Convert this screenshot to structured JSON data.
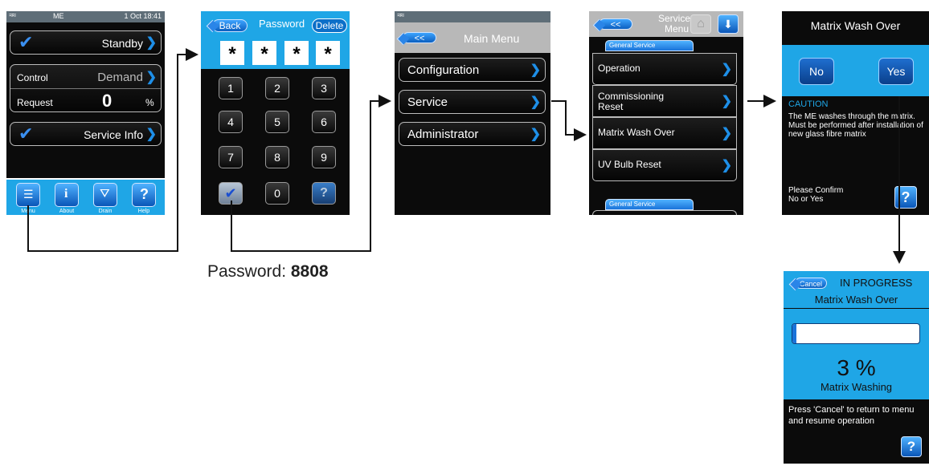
{
  "screen1": {
    "app_title": "ME",
    "datetime": "1 Oct 18:41",
    "standby_label": "Standby",
    "control_label": "Control",
    "control_value": "Demand",
    "request_label": "Request",
    "request_value": "0",
    "request_unit": "%",
    "service_info_label": "Service Info",
    "footer_icons": [
      {
        "name": "menu-icon",
        "label": "Menu"
      },
      {
        "name": "info-icon",
        "label": "About"
      },
      {
        "name": "drain-icon",
        "label": "Drain"
      },
      {
        "name": "help-icon",
        "label": "Help"
      }
    ]
  },
  "screen2": {
    "back_label": "Back",
    "title": "Password",
    "delete_label": "Delete",
    "masked": [
      "*",
      "*",
      "*",
      "*"
    ],
    "keys": [
      "1",
      "2",
      "3",
      "4",
      "5",
      "6",
      "7",
      "8",
      "9",
      "0"
    ],
    "caption_prefix": "Password: ",
    "caption_value": "8808"
  },
  "screen3": {
    "back_label": "<<",
    "title": "Main Menu",
    "items": [
      "Configuration",
      "Service",
      "Administrator"
    ]
  },
  "screen4": {
    "back_label": "<<",
    "title_line1": "Service",
    "title_line2": "Menu",
    "section_label": "General Service",
    "items": [
      {
        "line1": "Operation",
        "line2": ""
      },
      {
        "line1": "Commissioning",
        "line2": "Reset"
      },
      {
        "line1": "Matrix Wash Over",
        "line2": ""
      },
      {
        "line1": "UV Bulb Reset",
        "line2": ""
      }
    ],
    "section_label_2": "General Service"
  },
  "screen5": {
    "title": "Matrix Wash Over",
    "no_label": "No",
    "yes_label": "Yes",
    "caution_title": "CAUTION",
    "caution_text": "The ME washes through the matrix. Must be performed after installation of new glass fibre matrix",
    "confirm_line1": "Please Confirm",
    "confirm_line2": "No or Yes",
    "help_glyph": "?"
  },
  "screen6": {
    "cancel_label": "Cancel",
    "status": "IN PROGRESS",
    "title": "Matrix Wash Over",
    "progress_percent": 3,
    "percent_text": "3 %",
    "activity": "Matrix Washing",
    "hint": "Press 'Cancel' to return to menu and resume operation",
    "help_glyph": "?"
  },
  "colors": {
    "accent_blue": "#1a8fe3",
    "screen_cyan": "#2eb2ec",
    "panel_black": "#0b0b0b",
    "progress_fill": "#1a73d9"
  }
}
